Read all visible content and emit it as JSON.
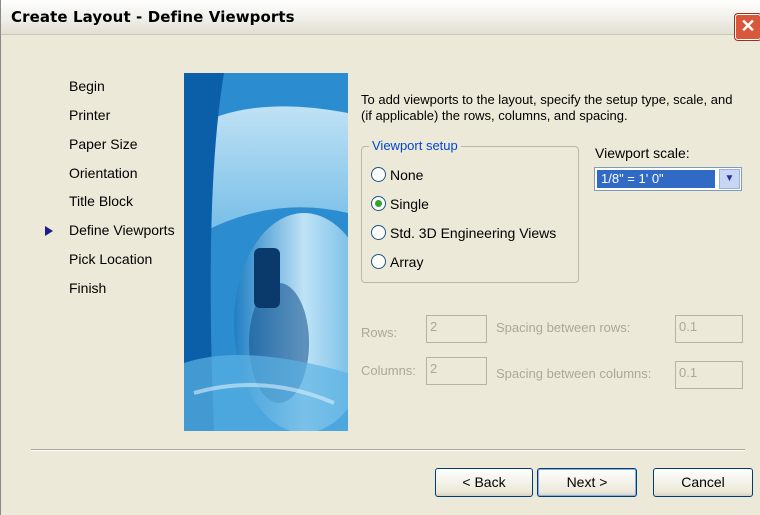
{
  "window": {
    "title": "Create Layout - Define Viewports",
    "close_glyph": "✕"
  },
  "steps": [
    "Begin",
    "Printer",
    "Paper Size",
    "Orientation",
    "Title Block",
    "Define Viewports",
    "Pick Location",
    "Finish"
  ],
  "current_step": "Define Viewports",
  "instructions": "To add viewports to the layout, specify the setup type, scale, and (if applicable) the rows, columns, and spacing.",
  "viewport_setup": {
    "legend": "Viewport setup",
    "options": [
      "None",
      "Single",
      "Std. 3D Engineering Views",
      "Array"
    ],
    "selected": "Single"
  },
  "viewport_scale": {
    "label": "Viewport scale:",
    "value": "1/8\" = 1' 0\""
  },
  "array_settings": {
    "rows_label": "Rows:",
    "rows_value": "2",
    "columns_label": "Columns:",
    "columns_value": "2",
    "spacing_rows_label": "Spacing between rows:",
    "spacing_rows_value": "0.1",
    "spacing_columns_label": "Spacing between columns:",
    "spacing_columns_value": "0.1"
  },
  "buttons": {
    "back": "< Back",
    "next": "Next >",
    "cancel": "Cancel"
  },
  "colors": {
    "dialog_bg": "#ece9d8",
    "accent_blue": "#0046d5",
    "selection": "#316ac5",
    "radio_dot": "#31a52f"
  }
}
